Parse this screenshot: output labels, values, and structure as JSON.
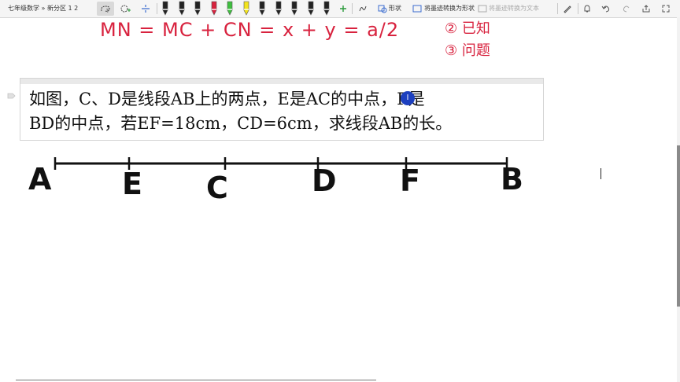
{
  "toolbar": {
    "title": "七年级数学 » 新分区 1 2",
    "shape_label": "形状",
    "ink_to_shape": "将墨迹转换为形状",
    "ink_to_text": "将墨迹转换为文本"
  },
  "handwriting": {
    "equation": "MN = MC + CN = x + y = a/2",
    "item2": "② 已知",
    "item3": "③ 问题"
  },
  "question": {
    "line1": "如图，C、D是线段AB上的两点，E是AC的中点，F是",
    "line2": "BD的中点，若EF=18cm，CD=6cm，求线段AB的长。"
  },
  "cursor": {
    "glyph": "I"
  },
  "diagram": {
    "points": [
      "A",
      "E",
      "C",
      "D",
      "F",
      "B"
    ]
  },
  "colors": {
    "ink_red": "#d8223e",
    "accent_blue": "#1c3fbf"
  },
  "pens": [
    "#222222",
    "#222222",
    "#222222",
    "#d8223e",
    "#3fbf3f",
    "#f2e31c",
    "#222222",
    "#222222",
    "#222222",
    "#222222",
    "#222222"
  ]
}
